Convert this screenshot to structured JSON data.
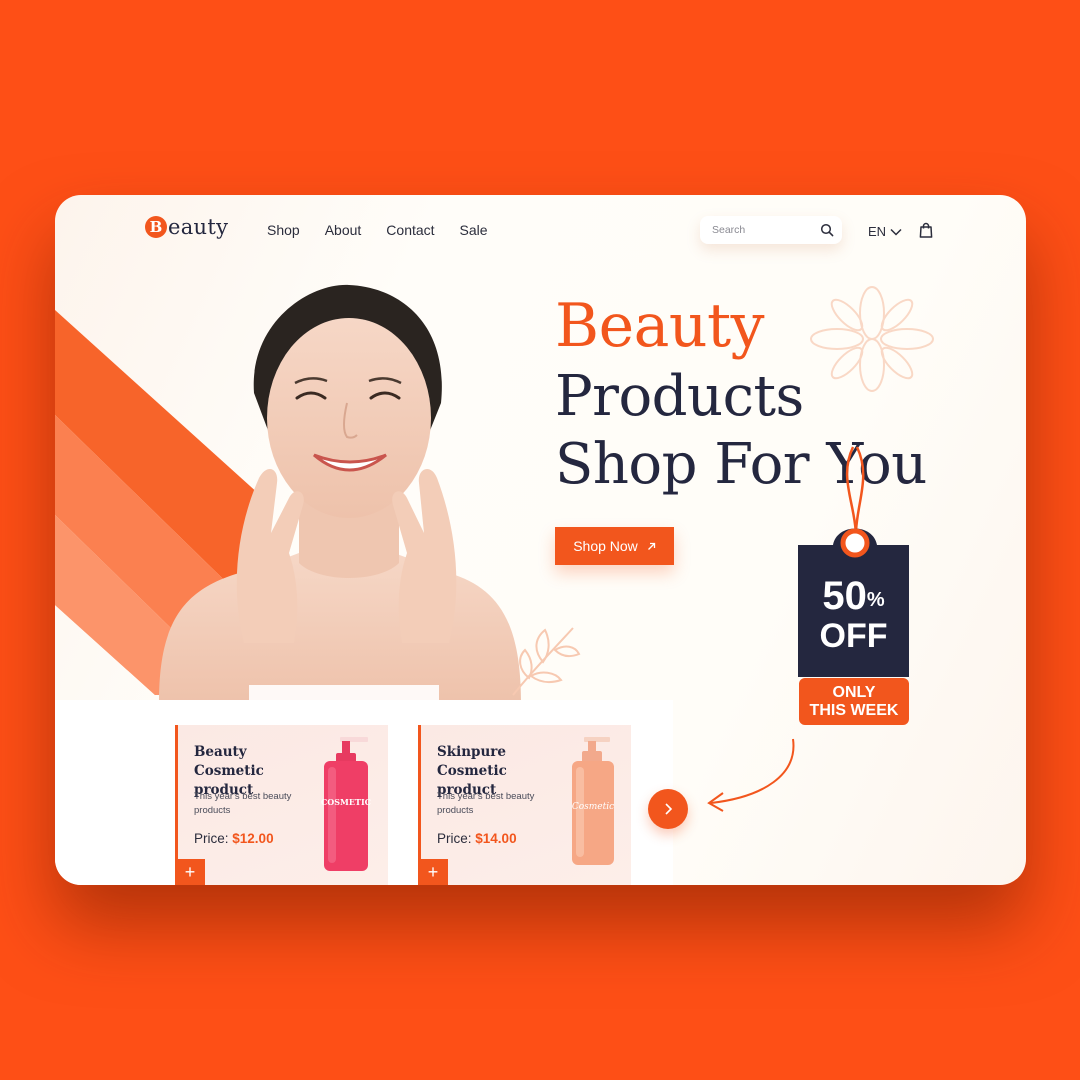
{
  "brand": {
    "mark": "B",
    "name": "eauty"
  },
  "nav": {
    "items": [
      "Shop",
      "About",
      "Contact",
      "Sale"
    ]
  },
  "search": {
    "placeholder": "Search"
  },
  "language": {
    "code": "EN"
  },
  "hero": {
    "accent": "Beauty",
    "line1": "Products",
    "line2": "Shop For You",
    "cta_label": "Shop Now"
  },
  "promo_tag": {
    "percent": "50",
    "percent_sign": "%",
    "off": "OFF",
    "line1": "ONLY",
    "line2": "THIS WEEK"
  },
  "products": [
    {
      "title": "Beauty Cosmetic product",
      "desc": "This year's best beauty products",
      "price_label": "Price:",
      "price": "$12.00",
      "bottle_text": "COSMETIC",
      "add_label": "+"
    },
    {
      "title": "Skinpure Cosmetic product",
      "desc": "This year's best beauty products",
      "price_label": "Price:",
      "price": "$14.00",
      "bottle_text": "Cosmetic",
      "add_label": "+"
    }
  ],
  "colors": {
    "background": "#fe4f16",
    "accent": "#f2561d",
    "navy": "#24273f"
  },
  "icons": [
    "search-icon",
    "chevron-down-icon",
    "shopping-bag-icon",
    "arrow-up-right-icon",
    "chevron-right-icon",
    "plus-icon"
  ]
}
